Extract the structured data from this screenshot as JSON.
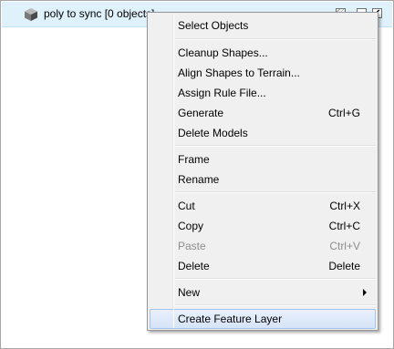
{
  "layer": {
    "name": "poly to sync [0 objects]",
    "icon": "cube-icon"
  },
  "menu": {
    "items": [
      {
        "label": "Select Objects",
        "shortcut": ""
      },
      {
        "label": "Cleanup Shapes...",
        "shortcut": ""
      },
      {
        "label": "Align Shapes to Terrain...",
        "shortcut": ""
      },
      {
        "label": "Assign Rule File...",
        "shortcut": ""
      },
      {
        "label": "Generate",
        "shortcut": "Ctrl+G"
      },
      {
        "label": "Delete Models",
        "shortcut": ""
      },
      {
        "label": "Frame",
        "shortcut": ""
      },
      {
        "label": "Rename",
        "shortcut": ""
      },
      {
        "label": "Cut",
        "shortcut": "Ctrl+X"
      },
      {
        "label": "Copy",
        "shortcut": "Ctrl+C"
      },
      {
        "label": "Paste",
        "shortcut": "Ctrl+V",
        "disabled": true
      },
      {
        "label": "Delete",
        "shortcut": "Delete"
      },
      {
        "label": "New",
        "shortcut": "",
        "submenu": true
      },
      {
        "label": "Create Feature Layer",
        "shortcut": "",
        "highlighted": true
      }
    ]
  },
  "colors": {
    "selected_row": "#dff1fb",
    "menu_highlight": "#d6e4f7",
    "disabled_text": "#8d8d8d"
  }
}
